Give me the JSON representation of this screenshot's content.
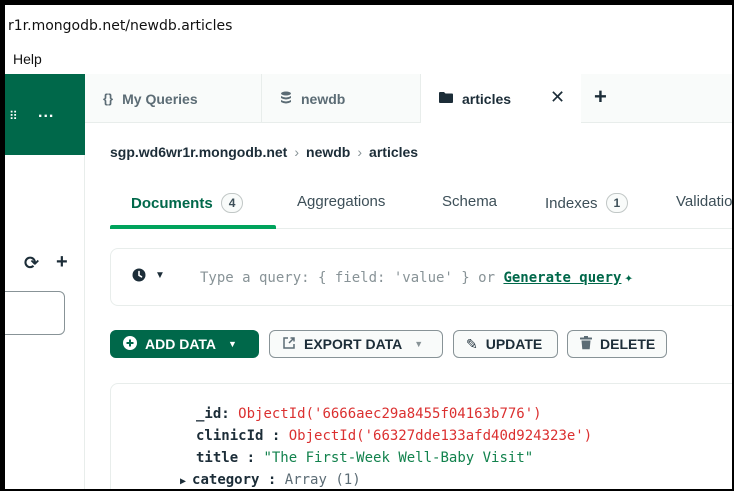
{
  "window": {
    "title": "r1r.mongodb.net/newdb.articles"
  },
  "menubar": {
    "help": "Help"
  },
  "sidebar": {
    "more_label": "..."
  },
  "tabs": [
    {
      "label": "My Queries",
      "icon": "curly-braces-icon"
    },
    {
      "label": "newdb",
      "icon": "database-icon"
    },
    {
      "label": "articles",
      "icon": "folder-icon",
      "active": true
    }
  ],
  "breadcrumb": [
    "sgp.wd6wr1r.mongodb.net",
    "newdb",
    "articles"
  ],
  "subtabs": [
    {
      "label": "Documents",
      "count": "4",
      "active": true
    },
    {
      "label": "Aggregations"
    },
    {
      "label": "Schema"
    },
    {
      "label": "Indexes",
      "count": "1"
    },
    {
      "label": "Validation"
    }
  ],
  "query": {
    "placeholder": "Type a query: { field: 'value' } or",
    "generate_label": "Generate query"
  },
  "actions": {
    "add": "ADD DATA",
    "export": "EXPORT DATA",
    "update": "UPDATE",
    "delete": "DELETE"
  },
  "document": {
    "id_key": "_id",
    "id_value": "ObjectId('6666aec29a8455f04163b776')",
    "clinic_key": "clinicId",
    "clinic_value": "ObjectId('66327dde133afd40d924323e')",
    "title_key": "title",
    "title_value": "\"The First-Week Well-Baby Visit\"",
    "category_key": "category",
    "category_value": "Array (1)"
  },
  "colors": {
    "brand": "#00684a",
    "accent": "#00a35c",
    "objectid": "#db3030"
  }
}
